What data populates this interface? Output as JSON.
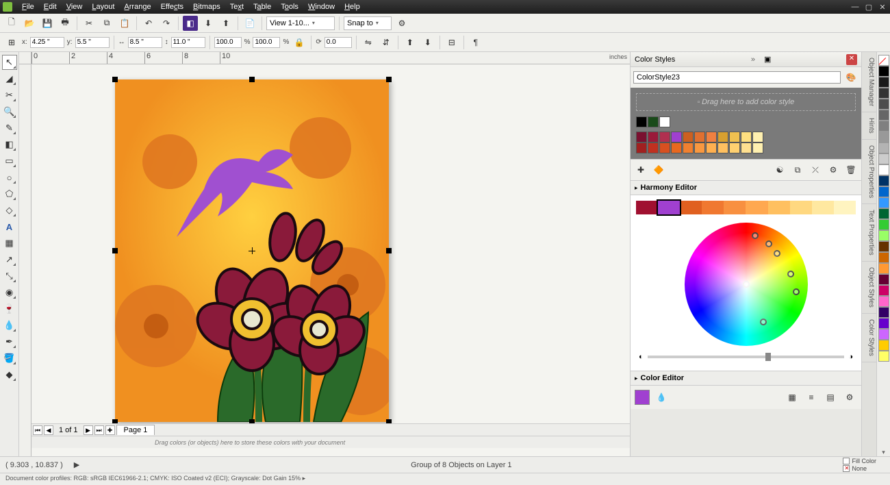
{
  "menu": [
    "File",
    "Edit",
    "View",
    "Layout",
    "Arrange",
    "Effects",
    "Bitmaps",
    "Text",
    "Table",
    "Tools",
    "Window",
    "Help"
  ],
  "toolbar1": {
    "zoom_combo": "View 1-10...",
    "snap_combo": "Snap to"
  },
  "property_bar": {
    "x_label": "x:",
    "x_val": "4.25 \"",
    "y_label": "y:",
    "y_val": "5.5 \"",
    "w_val": "8.5 \"",
    "h_val": "11.0 \"",
    "scale_x": "100.0",
    "scale_y": "100.0",
    "pct": "%",
    "rot": "0.0"
  },
  "ruler_unit": "inches",
  "ruler_marks": [
    "0",
    "2",
    "4",
    "6",
    "8",
    "10"
  ],
  "page_nav": {
    "page_of": "1 of 1",
    "tab": "Page 1"
  },
  "color_tray_hint": "Drag colors (or objects) here to store these colors with your document",
  "docker": {
    "color_styles_title": "Color Styles",
    "style_name": "ColorStyle23",
    "drop_hint": "Drag here to add color style",
    "row1": [
      "#000000",
      "#1a4a1a",
      "#ffffff"
    ],
    "row2": [
      "#7a1030",
      "#9a1a3a",
      "#b03050",
      "#a040d0",
      "#cc6020",
      "#e07030",
      "#f08040",
      "#d8a030",
      "#f0c050",
      "#ffe080",
      "#fff0b0"
    ],
    "row3": [
      "#a02020",
      "#c03020",
      "#d85020",
      "#e86820",
      "#f08030",
      "#f89840",
      "#ffb050",
      "#ffc060",
      "#ffd070",
      "#ffe090",
      "#fff0b0"
    ],
    "harmony_title": "Harmony Editor",
    "harmony_strip": [
      "#a01030",
      "#a040d0",
      "#e06020",
      "#f07830",
      "#f89040",
      "#ffa850",
      "#ffc060",
      "#ffd880",
      "#ffe8a0",
      "#fff4c0"
    ],
    "color_editor_title": "Color Editor"
  },
  "side_tabs": [
    "Object Manager",
    "Hints",
    "Object Properties",
    "Text Properties",
    "Object Styles",
    "Color Styles"
  ],
  "palette": [
    "#000000",
    "#1a1a1a",
    "#333333",
    "#4d4d4d",
    "#666666",
    "#808080",
    "#999999",
    "#b3b3b3",
    "#cccccc",
    "#ffffff",
    "#003366",
    "#0066cc",
    "#3399ff",
    "#006633",
    "#33cc33",
    "#99ff66",
    "#663300",
    "#cc6600",
    "#ff9933",
    "#660033",
    "#cc0066",
    "#ff66cc",
    "#330066",
    "#6600cc",
    "#cc66ff",
    "#ffcc00",
    "#ffff66"
  ],
  "status": {
    "coords": "( 9.303 , 10.837 )",
    "selection": "Group of 8 Objects on Layer 1",
    "fill": "Fill Color",
    "none": "None"
  },
  "profiles": "Document color profiles: RGB: sRGB IEC61966-2.1; CMYK: ISO Coated v2 (ECI); Grayscale: Dot Gain 15% ▸"
}
